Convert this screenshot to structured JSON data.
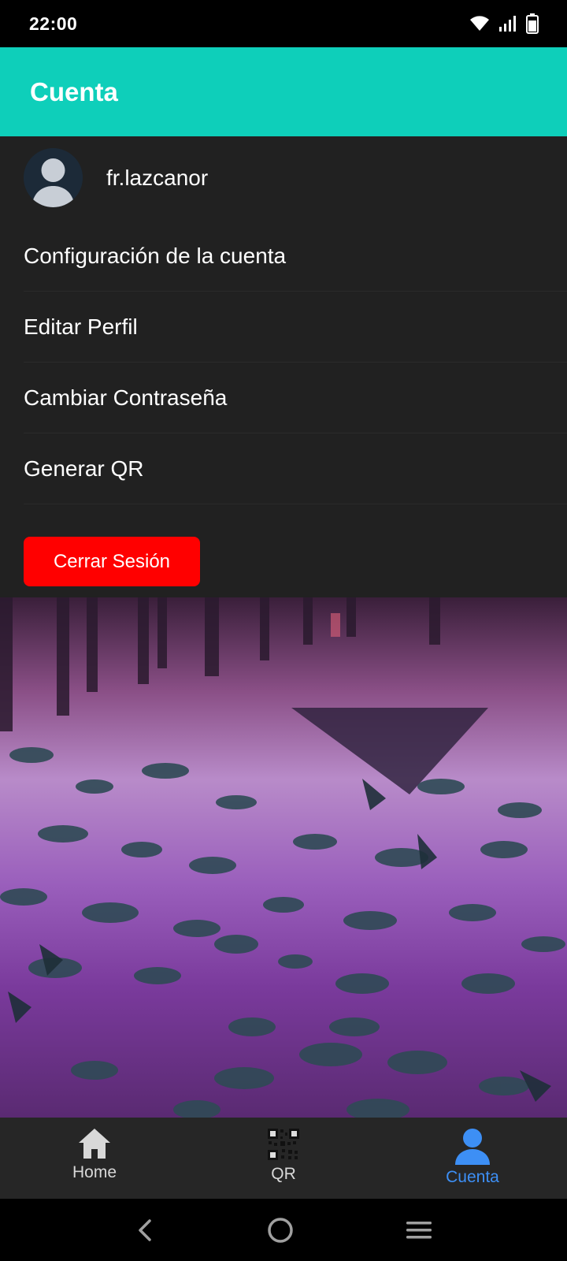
{
  "status_bar": {
    "time": "22:00",
    "icons": [
      "wifi-icon",
      "signal-icon",
      "battery-icon"
    ]
  },
  "app_bar": {
    "title": "Cuenta",
    "color": "#0ecfba"
  },
  "profile": {
    "username": "fr.lazcanor",
    "avatar": "avatar-placeholder-icon"
  },
  "menu": {
    "items": [
      {
        "label": "Configuración de la cuenta"
      },
      {
        "label": "Editar Perfil"
      },
      {
        "label": "Cambiar Contraseña"
      },
      {
        "label": "Generar QR"
      }
    ]
  },
  "logout": {
    "label": "Cerrar Sesión",
    "color": "#ff0000"
  },
  "bottom_nav": {
    "items": [
      {
        "label": "Home",
        "icon": "home-icon"
      },
      {
        "label": "QR",
        "icon": "qr-code-icon"
      },
      {
        "label": "Cuenta",
        "icon": "person-icon",
        "active": true
      }
    ],
    "active_color": "#3d8ff5"
  },
  "system_nav": {
    "icons": [
      "back-icon",
      "home-circle-icon",
      "recents-menu-icon"
    ]
  }
}
